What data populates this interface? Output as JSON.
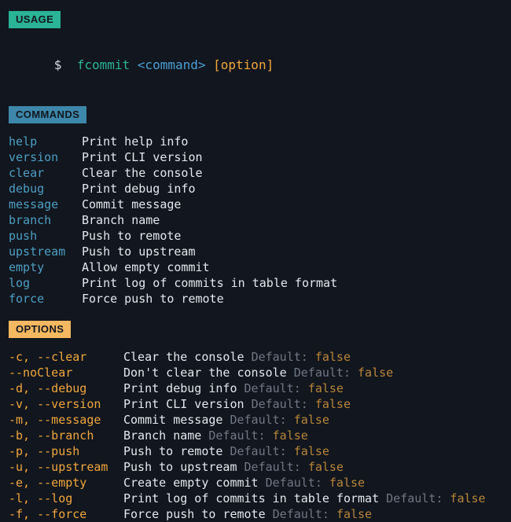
{
  "theme": {
    "background": "#12161e",
    "text": "#e3e9f0",
    "usage_badge_bg": "#2bb396",
    "commands_badge_bg": "#3d87aa",
    "options_badge_bg": "#f4b860",
    "badge_text": "#12161e",
    "command_name": "#4d9fc4",
    "option_flag": "#f0a73d",
    "default_label": "#6f7885",
    "default_value": "#b8863b",
    "binary": "#2bb396",
    "placeholder": "#4a9fd4"
  },
  "sections": {
    "usage": {
      "badge": "USAGE",
      "line": {
        "prompt": "$",
        "binary": "fcommit",
        "command_placeholder": "<command>",
        "option_placeholder": "[option]"
      }
    },
    "commands": {
      "badge": "COMMANDS",
      "items": [
        {
          "name": "help",
          "description": "Print help info"
        },
        {
          "name": "version",
          "description": "Print CLI version"
        },
        {
          "name": "clear",
          "description": "Clear the console"
        },
        {
          "name": "debug",
          "description": "Print debug info"
        },
        {
          "name": "message",
          "description": "Commit message"
        },
        {
          "name": "branch",
          "description": "Branch name"
        },
        {
          "name": "push",
          "description": "Push to remote"
        },
        {
          "name": "upstream",
          "description": "Push to upstream"
        },
        {
          "name": "empty",
          "description": "Allow empty commit"
        },
        {
          "name": "log",
          "description": "Print log of commits in table format"
        },
        {
          "name": "force",
          "description": "Force push to remote"
        }
      ]
    },
    "options": {
      "badge": "OPTIONS",
      "default_label": "Default:",
      "items": [
        {
          "flags": "-c, --clear",
          "description": "Clear the console",
          "default": "false"
        },
        {
          "flags": "--noClear",
          "description": "Don't clear the console",
          "default": "false"
        },
        {
          "flags": "-d, --debug",
          "description": "Print debug info",
          "default": "false"
        },
        {
          "flags": "-v, --version",
          "description": "Print CLI version",
          "default": "false"
        },
        {
          "flags": "-m, --message",
          "description": "Commit message",
          "default": "false"
        },
        {
          "flags": "-b, --branch",
          "description": "Branch name",
          "default": "false"
        },
        {
          "flags": "-p, --push",
          "description": "Push to remote",
          "default": "false"
        },
        {
          "flags": "-u, --upstream",
          "description": "Push to upstream",
          "default": "false"
        },
        {
          "flags": "-e, --empty",
          "description": "Create empty commit",
          "default": "false"
        },
        {
          "flags": "-l, --log",
          "description": "Print log of commits in table format",
          "default": "false"
        },
        {
          "flags": "-f, --force",
          "description": "Force push to remote",
          "default": "false"
        }
      ]
    }
  }
}
